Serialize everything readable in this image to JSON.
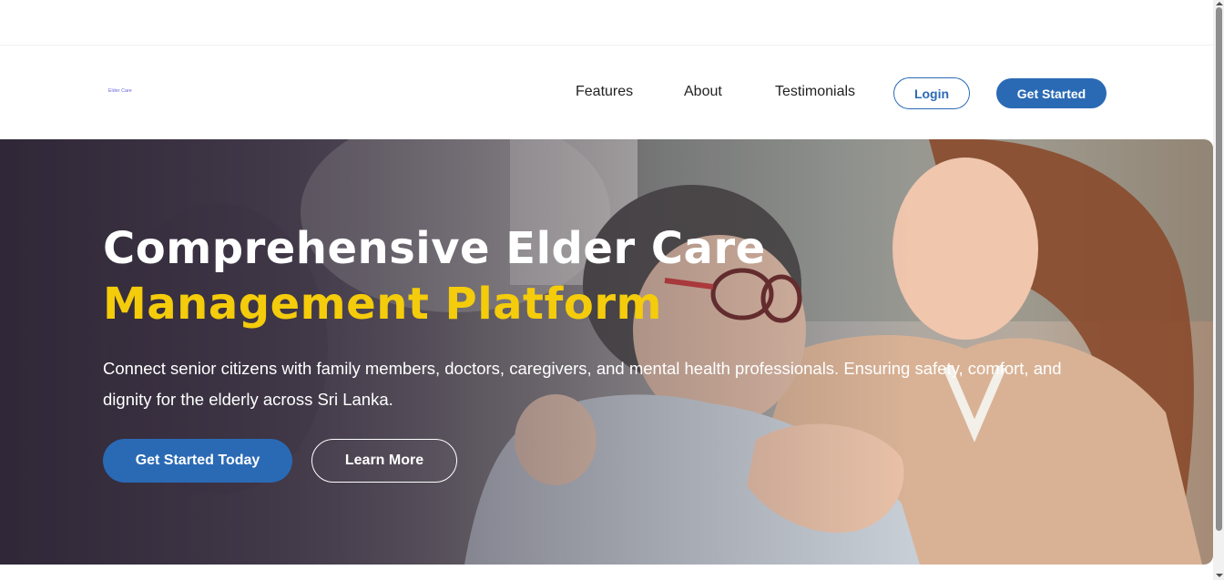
{
  "nav": {
    "logo_text": "Elder Care",
    "links": [
      "Features",
      "About",
      "Testimonials"
    ],
    "login_label": "Login",
    "get_started_label": "Get Started"
  },
  "hero": {
    "title_line1": "Comprehensive Elder Care",
    "title_line2": "Management Platform",
    "description": "Connect senior citizens with family members, doctors, caregivers, and mental health professionals. Ensuring safety, comfort, and dignity for the elderly across Sri Lanka.",
    "primary_cta": "Get Started Today",
    "secondary_cta": "Learn More",
    "image_alt": "Smiling caregiver with elderly woman"
  },
  "colors": {
    "brand_blue": "#2a6ab5",
    "accent_yellow": "#f4cc0b"
  }
}
